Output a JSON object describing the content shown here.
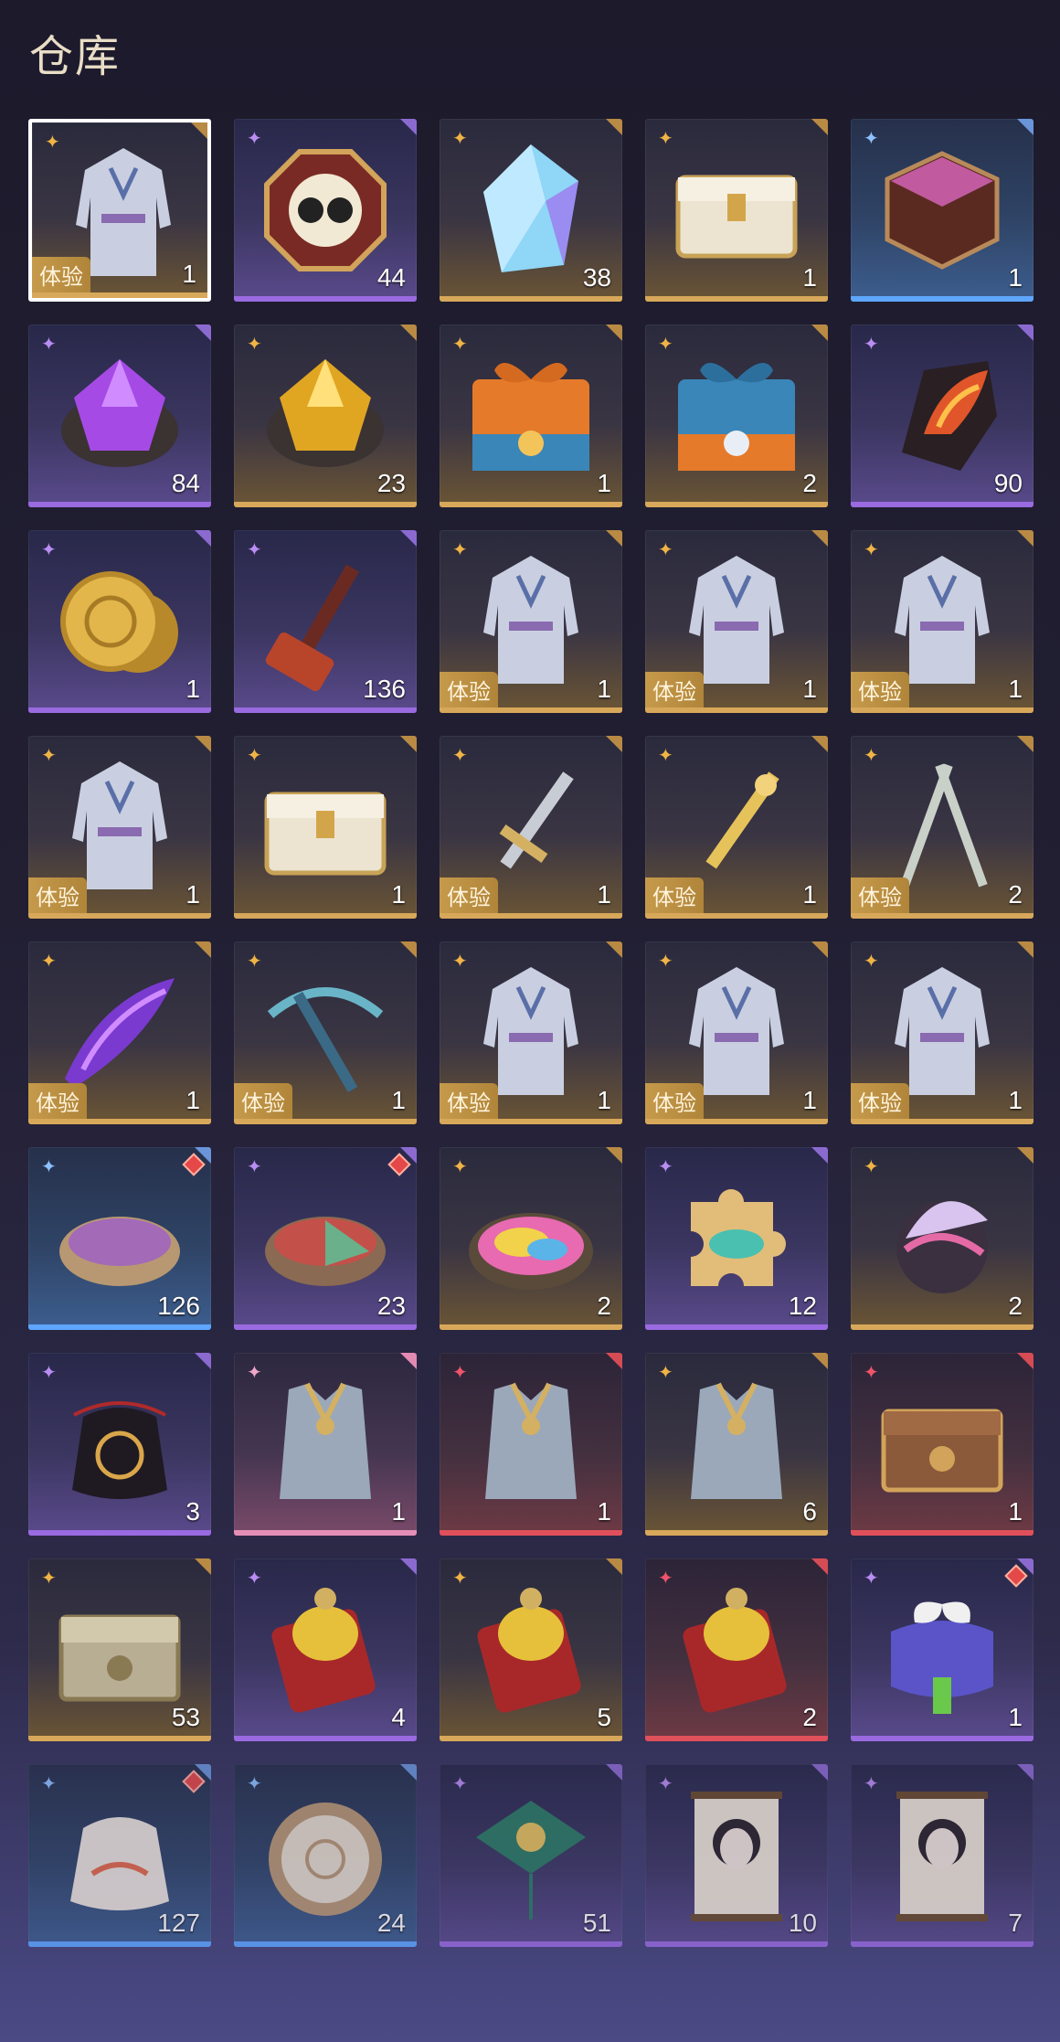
{
  "header": {
    "title": "仓库"
  },
  "trial_label": "体验",
  "rarity_badge": {
    "gold": "✦",
    "purple": "✦",
    "blue": "✦",
    "red": "✦",
    "pink": "✦"
  },
  "rarity_colors": {
    "gold": "#d8a85a",
    "purple": "#9a6ae0",
    "blue": "#5ea6ff",
    "red": "#e0505b",
    "pink": "#e58fb7"
  },
  "items": [
    {
      "icon": "costume-icon",
      "rarity": "gold",
      "count": "1",
      "trial": true,
      "selected": true
    },
    {
      "icon": "octagon-medallion-icon",
      "rarity": "purple",
      "count": "44"
    },
    {
      "icon": "crystal-icon",
      "rarity": "gold",
      "count": "38"
    },
    {
      "icon": "white-chest-icon",
      "rarity": "gold",
      "count": "1"
    },
    {
      "icon": "hexagon-box-icon",
      "rarity": "blue",
      "count": "1"
    },
    {
      "icon": "purple-gem-icon",
      "rarity": "purple",
      "count": "84"
    },
    {
      "icon": "gold-gem-icon",
      "rarity": "gold",
      "count": "23"
    },
    {
      "icon": "gift-bundle-orange-icon",
      "rarity": "gold",
      "count": "1"
    },
    {
      "icon": "gift-bundle-blue-icon",
      "rarity": "gold",
      "count": "2"
    },
    {
      "icon": "fire-ore-icon",
      "rarity": "purple",
      "count": "90"
    },
    {
      "icon": "gold-coin-icon",
      "rarity": "purple",
      "count": "1"
    },
    {
      "icon": "hammer-icon",
      "rarity": "purple",
      "count": "136"
    },
    {
      "icon": "costume-icon",
      "rarity": "gold",
      "count": "1",
      "trial": true
    },
    {
      "icon": "costume-icon",
      "rarity": "gold",
      "count": "1",
      "trial": true
    },
    {
      "icon": "costume-icon",
      "rarity": "gold",
      "count": "1",
      "trial": true
    },
    {
      "icon": "costume-icon",
      "rarity": "gold",
      "count": "1",
      "trial": true
    },
    {
      "icon": "white-chest-icon",
      "rarity": "gold",
      "count": "1"
    },
    {
      "icon": "sword-icon",
      "rarity": "gold",
      "count": "1",
      "trial": true
    },
    {
      "icon": "golden-sword-icon",
      "rarity": "gold",
      "count": "1",
      "trial": true
    },
    {
      "icon": "twin-blades-icon",
      "rarity": "gold",
      "count": "2",
      "trial": true
    },
    {
      "icon": "purple-blade-icon",
      "rarity": "gold",
      "count": "1",
      "trial": true
    },
    {
      "icon": "crossbow-icon",
      "rarity": "gold",
      "count": "1",
      "trial": true
    },
    {
      "icon": "costume-icon",
      "rarity": "gold",
      "count": "1",
      "trial": true
    },
    {
      "icon": "costume-icon",
      "rarity": "gold",
      "count": "1",
      "trial": true
    },
    {
      "icon": "costume-icon",
      "rarity": "gold",
      "count": "1",
      "trial": true
    },
    {
      "icon": "dye-bowl-icon",
      "rarity": "blue",
      "count": "126",
      "flag": true
    },
    {
      "icon": "dye-bowl-tri-icon",
      "rarity": "purple",
      "count": "23",
      "flag": true
    },
    {
      "icon": "rainbow-dye-icon",
      "rarity": "gold",
      "count": "2"
    },
    {
      "icon": "puzzle-piece-icon",
      "rarity": "purple",
      "count": "12"
    },
    {
      "icon": "silk-orb-icon",
      "rarity": "gold",
      "count": "2"
    },
    {
      "icon": "pouch-icon",
      "rarity": "purple",
      "count": "3"
    },
    {
      "icon": "vest-icon",
      "rarity": "pink",
      "count": "1"
    },
    {
      "icon": "vest-icon",
      "rarity": "red",
      "count": "1"
    },
    {
      "icon": "vest-icon",
      "rarity": "gold",
      "count": "6"
    },
    {
      "icon": "bronze-chest-icon",
      "rarity": "red",
      "count": "1"
    },
    {
      "icon": "silver-chest-icon",
      "rarity": "gold",
      "count": "53"
    },
    {
      "icon": "lantern-token-icon",
      "rarity": "purple",
      "count": "4"
    },
    {
      "icon": "lantern-token-icon",
      "rarity": "gold",
      "count": "5"
    },
    {
      "icon": "lantern-token-icon",
      "rarity": "red",
      "count": "2"
    },
    {
      "icon": "purple-gift-icon",
      "rarity": "purple",
      "count": "1",
      "flag": true
    },
    {
      "icon": "silk-bag-icon",
      "rarity": "blue",
      "count": "127",
      "flag": true,
      "fade": true
    },
    {
      "icon": "drum-icon",
      "rarity": "blue",
      "count": "24",
      "fade": true
    },
    {
      "icon": "kite-icon",
      "rarity": "purple",
      "count": "51",
      "fade": true
    },
    {
      "icon": "portrait-scroll-icon",
      "rarity": "purple",
      "count": "10",
      "fade": true
    },
    {
      "icon": "portrait-scroll-icon",
      "rarity": "purple",
      "count": "7",
      "fade": true
    }
  ]
}
